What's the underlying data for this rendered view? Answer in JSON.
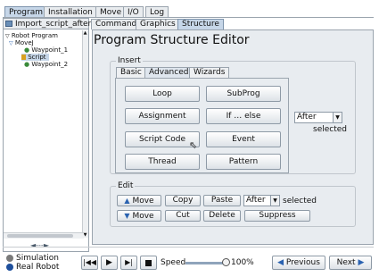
{
  "top_tabs": [
    "Program",
    "Installation",
    "Move",
    "I/O",
    "Log"
  ],
  "program": {
    "name": "Import_script_after",
    "tree": [
      "Robot Program",
      "MoveJ",
      "Waypoint_1",
      "Script",
      "Waypoint_2"
    ],
    "scroll_nav": "◄---►"
  },
  "panel_tabs": [
    "Command",
    "Graphics",
    "Structure"
  ],
  "editor": {
    "title": "Program Structure Editor",
    "insert_label": "Insert",
    "insert_tabs": [
      "Basic",
      "Advanced",
      "Wizards"
    ],
    "insert_buttons": [
      "Loop",
      "SubProg",
      "Assignment",
      "If … else",
      "Script Code",
      "Event",
      "Thread",
      "Pattern"
    ],
    "insert_position": "After",
    "selected_label": "selected",
    "edit_label": "Edit",
    "edit_move_up": "Move",
    "edit_move_down": "Move",
    "edit_copy": "Copy",
    "edit_paste": "Paste",
    "edit_position": "After",
    "edit_cut": "Cut",
    "edit_delete": "Delete",
    "edit_suppress": "Suppress"
  },
  "bottom": {
    "simulation": "Simulation",
    "real_robot": "Real Robot",
    "speed_label": "Speed",
    "speed_value": "100%",
    "speed_fraction": 1.0,
    "previous": "Previous",
    "next": "Next"
  },
  "colors": {
    "active_tab": "#c6d6e8",
    "panel_bg": "#e8ecf0",
    "simulation_icon": "#7a7a7a",
    "real_robot_icon": "#1e4f9c"
  }
}
